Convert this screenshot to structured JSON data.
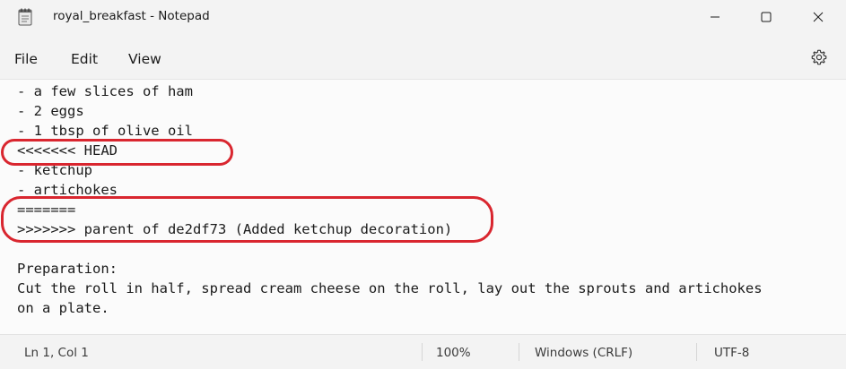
{
  "window": {
    "title": "royal_breakfast - Notepad"
  },
  "menu": {
    "file": "File",
    "edit": "Edit",
    "view": "View"
  },
  "editor": {
    "lines": [
      "- a few slices of ham",
      "- 2 eggs",
      "- 1 tbsp of olive oil",
      "<<<<<<< HEAD",
      "- ketchup",
      "- artichokes",
      "=======",
      ">>>>>>> parent of de2df73 (Added ketchup decoration)",
      "",
      "Preparation:",
      "Cut the roll in half, spread cream cheese on the roll, lay out the sprouts and artichokes",
      "on a plate."
    ]
  },
  "status": {
    "position": "Ln 1, Col 1",
    "zoom": "100%",
    "line_endings": "Windows (CRLF)",
    "encoding": "UTF-8"
  },
  "colors": {
    "highlight": "#d9262f",
    "background": "#fbfbfb",
    "chrome": "#f3f3f3"
  },
  "icons": {
    "app": "notepad-icon",
    "minimize": "minimize-icon",
    "maximize": "maximize-icon",
    "close": "close-icon",
    "settings": "gear-icon"
  }
}
